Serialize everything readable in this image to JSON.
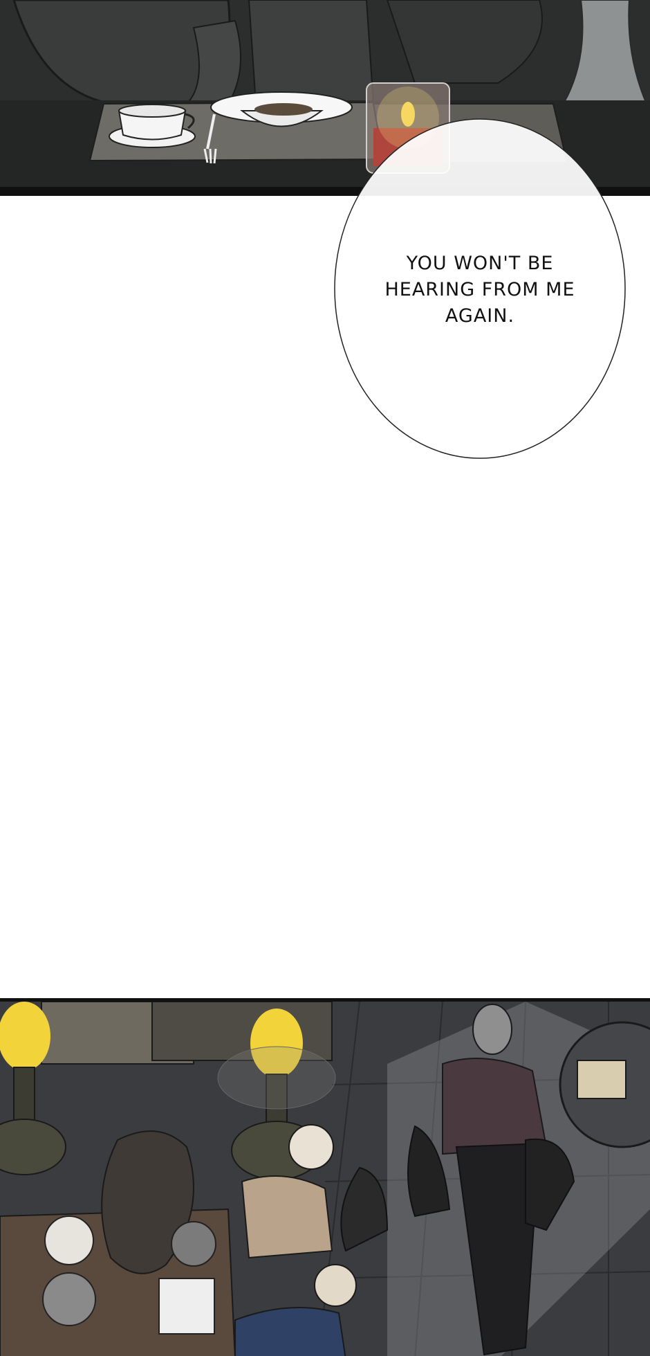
{
  "dialogue": {
    "speech_bubble_text": "YOU WON'T BE\nHEARING FROM ME\nAGAIN."
  },
  "colors": {
    "panel_dark": "#2f3130",
    "floor_tile": "#3a3b3d",
    "lamp_glow": "#f2d33a",
    "bubble_fill": "#ffffff",
    "page_background": "#ffffff"
  }
}
